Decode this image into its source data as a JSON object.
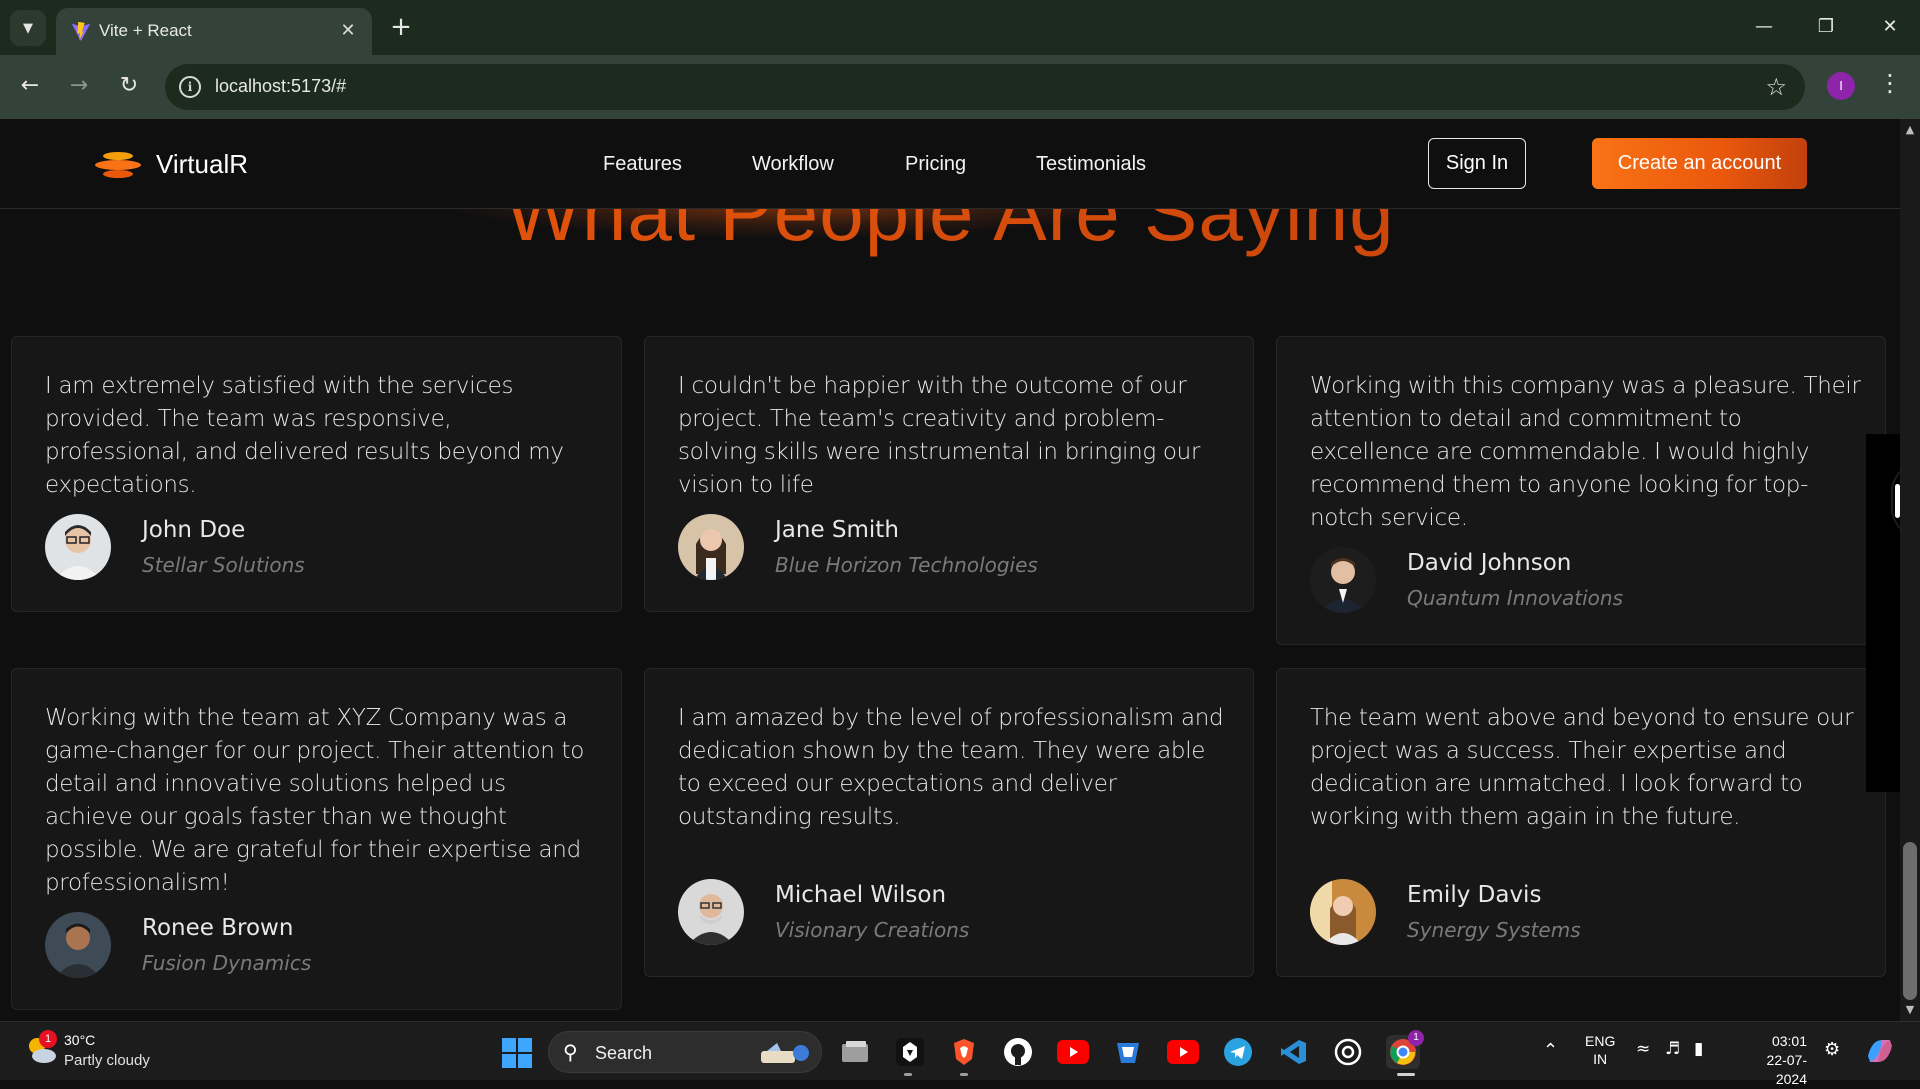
{
  "browser": {
    "tab_title": "Vite + React",
    "url": "localhost:5173/#",
    "profile_initial": "I",
    "accent": "#34433a"
  },
  "site": {
    "brand": "VirtualR",
    "nav": [
      "Features",
      "Workflow",
      "Pricing",
      "Testimonials"
    ],
    "sign_in": "Sign In",
    "cta": "Create an account",
    "accent_color": "#ea580c",
    "section_title": "What People Are Saying"
  },
  "testimonials": [
    {
      "name": "John Doe",
      "company": "Stellar Solutions",
      "text": "I am extremely satisfied with the services provided. The team was responsive, professional, and delivered results beyond my expectations."
    },
    {
      "name": "Jane Smith",
      "company": "Blue Horizon Technologies",
      "text": "I couldn't be happier with the outcome of our project. The team's creativity and problem-solving skills were instrumental in bringing our vision to life"
    },
    {
      "name": "David Johnson",
      "company": "Quantum Innovations",
      "text": "Working with this company was a pleasure. Their attention to detail and commitment to excellence are commendable. I would highly recommend them to anyone looking for top-notch service."
    },
    {
      "name": "Ronee Brown",
      "company": "Fusion Dynamics",
      "text": "Working with the team at XYZ Company was a game-changer for our project. Their attention to detail and innovative solutions helped us achieve our goals faster than we thought possible. We are grateful for their expertise and professionalism!"
    },
    {
      "name": "Michael Wilson",
      "company": "Visionary Creations",
      "text": "I am amazed by the level of professionalism and dedication shown by the team. They were able to exceed our expectations and deliver outstanding results."
    },
    {
      "name": "Emily Davis",
      "company": "Synergy Systems",
      "text": "The team went above and beyond to ensure our project was a success. Their expertise and dedication are unmatched. I look forward to working with them again in the future."
    }
  ],
  "taskbar": {
    "weather_temp": "30°C",
    "weather_cond": "Partly cloudy",
    "weather_badge": "1",
    "search_label": "Search",
    "lang_top": "ENG",
    "lang_bottom": "IN",
    "time": "03:01",
    "date": "22-07-2024",
    "chrome_badge": "1"
  }
}
